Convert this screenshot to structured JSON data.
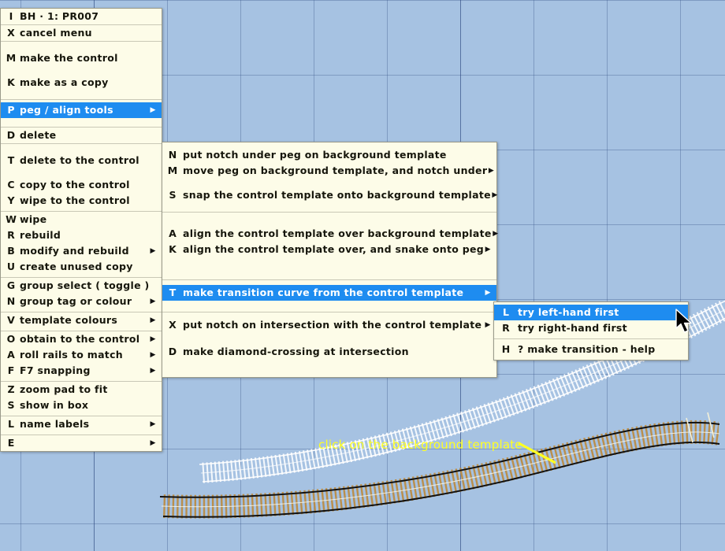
{
  "app": {
    "pad_bg_color": "#a6c2e2",
    "menu_bg_color": "#fdfce8",
    "highlight_color": "#1e8cf0",
    "annotation_color": "#ffff22"
  },
  "annotation": {
    "text": "click on the background template"
  },
  "root_menu": {
    "title_key": "I",
    "title_label": "BH · 1: PR007",
    "items": [
      {
        "key": "X",
        "label": "cancel menu",
        "arrow": false
      },
      {
        "key": "M",
        "label": "make the control",
        "arrow": false
      },
      {
        "key": "K",
        "label": "make as a copy",
        "arrow": false
      },
      {
        "key": "P",
        "label": "peg / align tools",
        "arrow": true,
        "selected": true
      },
      {
        "key": "D",
        "label": "delete",
        "arrow": false
      },
      {
        "key": "T",
        "label": "delete to the control",
        "arrow": false
      },
      {
        "key": "C",
        "label": "copy to the control",
        "arrow": false
      },
      {
        "key": "Y",
        "label": "wipe to the control",
        "arrow": false
      },
      {
        "key": "W",
        "label": "wipe",
        "arrow": false
      },
      {
        "key": "R",
        "label": "rebuild",
        "arrow": false
      },
      {
        "key": "B",
        "label": "modify and rebuild",
        "arrow": true
      },
      {
        "key": "U",
        "label": "create unused copy",
        "arrow": false
      },
      {
        "key": "G",
        "label": "group select ( toggle )",
        "arrow": false
      },
      {
        "key": "N",
        "label": "group tag or colour",
        "arrow": true
      },
      {
        "key": "V",
        "label": "template colours",
        "arrow": true
      },
      {
        "key": "O",
        "label": "obtain to the control",
        "arrow": true
      },
      {
        "key": "A",
        "label": "roll rails to match",
        "arrow": true
      },
      {
        "key": "F",
        "label": "F7 snapping",
        "arrow": true
      },
      {
        "key": "Z",
        "label": "zoom pad to fit",
        "arrow": false
      },
      {
        "key": "S",
        "label": "show in box",
        "arrow": false
      },
      {
        "key": "L",
        "label": "name labels",
        "arrow": true
      },
      {
        "key": "E",
        "label": "",
        "arrow": true
      }
    ]
  },
  "peg_menu": {
    "items": [
      {
        "key": "N",
        "label": "put notch under peg on background template",
        "arrow": false
      },
      {
        "key": "M",
        "label": "move peg on background template, and notch under",
        "arrow": true
      },
      {
        "key": "S",
        "label": "snap the control template onto background template",
        "arrow": true
      },
      {
        "key": "A",
        "label": "align the control template over background template",
        "arrow": true
      },
      {
        "key": "K",
        "label": "align the control template over, and snake onto peg",
        "arrow": true
      },
      {
        "key": "T",
        "label": "make transition curve from the control template",
        "arrow": true,
        "selected": true
      },
      {
        "key": "X",
        "label": "put notch on intersection with the control template",
        "arrow": true
      },
      {
        "key": "D",
        "label": "make diamond-crossing at intersection",
        "arrow": false
      }
    ]
  },
  "transition_menu": {
    "items": [
      {
        "key": "L",
        "label": "try left-hand first",
        "arrow": false,
        "selected": true
      },
      {
        "key": "R",
        "label": "try right-hand first",
        "arrow": false
      },
      {
        "key": "H",
        "label": "? make transition - help",
        "arrow": false
      }
    ]
  }
}
